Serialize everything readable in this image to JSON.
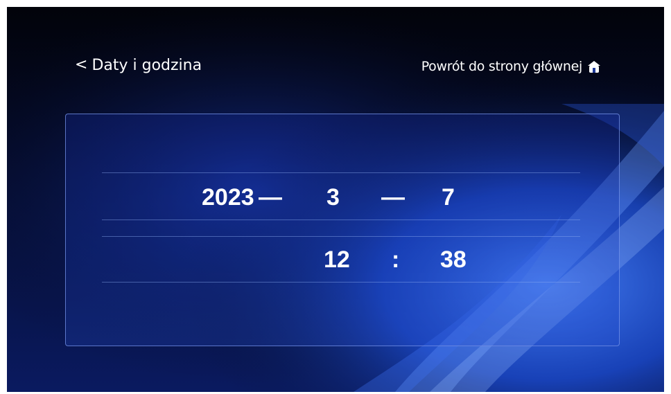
{
  "header": {
    "back_chevron": "<",
    "back_label": "Daty i godzina",
    "home_label": "Powrót do strony głównej",
    "home_icon": "home-icon"
  },
  "date": {
    "year": "2023",
    "sep1": "—",
    "month": "3",
    "sep2": "—",
    "day": "7"
  },
  "time": {
    "hour": "12",
    "sep": ":",
    "minute": "38"
  },
  "colors": {
    "background": "#03040a",
    "accent_blue": "#1f4fd8",
    "panel_border": "#7896eb",
    "text": "#ffffff"
  }
}
